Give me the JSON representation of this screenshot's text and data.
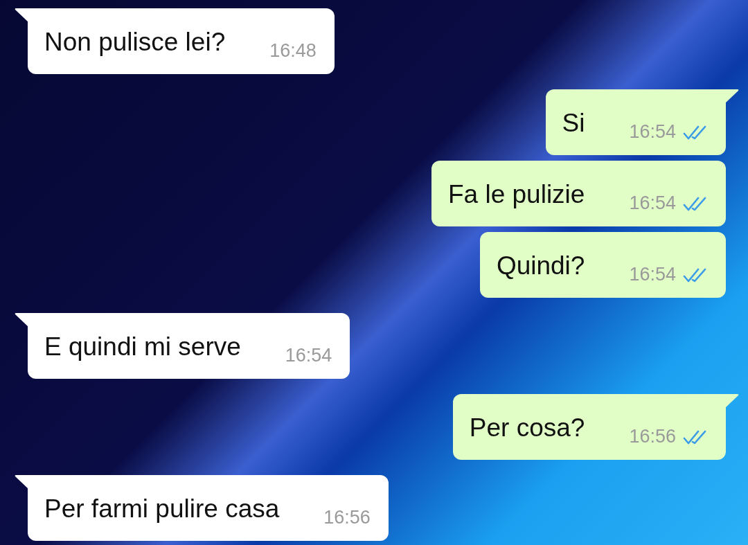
{
  "messages": [
    {
      "kind": "received",
      "text": "Non pulisce lei?",
      "time": "16:48",
      "tail": true
    },
    {
      "kind": "sent",
      "text": "Si",
      "time": "16:54",
      "tail": true,
      "read": true
    },
    {
      "kind": "sent",
      "text": "Fa le pulizie",
      "time": "16:54",
      "tail": false,
      "read": true
    },
    {
      "kind": "sent",
      "text": "Quindi?",
      "time": "16:54",
      "tail": false,
      "read": true
    },
    {
      "kind": "received",
      "text": "E quindi mi serve",
      "time": "16:54",
      "tail": true
    },
    {
      "kind": "sent",
      "text": "Per cosa?",
      "time": "16:56",
      "tail": true,
      "read": true
    },
    {
      "kind": "received",
      "text": "Per farmi pulire casa",
      "time": "16:56",
      "tail": true
    }
  ]
}
